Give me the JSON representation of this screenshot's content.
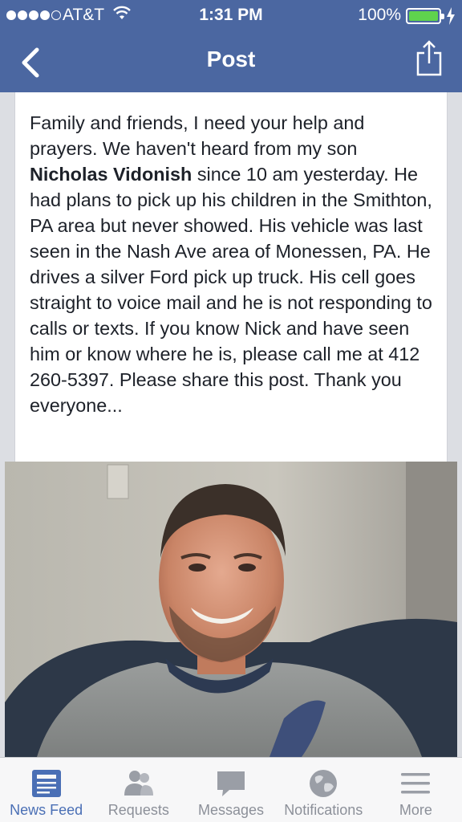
{
  "status_bar": {
    "carrier": "AT&T",
    "time": "1:31 PM",
    "battery_percent": "100%",
    "signal_bars": 4,
    "signal_total": 5
  },
  "nav": {
    "title": "Post",
    "back_icon": "chevron-left-icon",
    "share_icon": "share-icon"
  },
  "post": {
    "text_before": "Family and friends, I need your help and prayers. We haven't heard from my son ",
    "name": "Nicholas Vidonish",
    "text_after": " since 10 am yesterday. He had plans to pick up his children in the Smithton, PA area but never showed.  His vehicle was last seen in the Nash Ave area of Monessen, PA.  He drives a silver Ford pick up truck.  His cell goes straight to voice mail and he is not responding to calls or texts.  If you know Nick and have seen him or know where he is, please call me at 412 260-5397.  Please share this post. Thank you everyone..."
  },
  "tabs": [
    {
      "label": "News Feed",
      "icon": "news-feed-icon",
      "active": true
    },
    {
      "label": "Requests",
      "icon": "requests-icon",
      "active": false
    },
    {
      "label": "Messages",
      "icon": "messages-icon",
      "active": false
    },
    {
      "label": "Notifications",
      "icon": "notifications-icon",
      "active": false
    },
    {
      "label": "More",
      "icon": "more-icon",
      "active": false
    }
  ],
  "colors": {
    "header": "#4b67a1",
    "active_tab": "#4a6fb5",
    "inactive_tab": "#8c9099",
    "battery": "#5fd34d"
  }
}
